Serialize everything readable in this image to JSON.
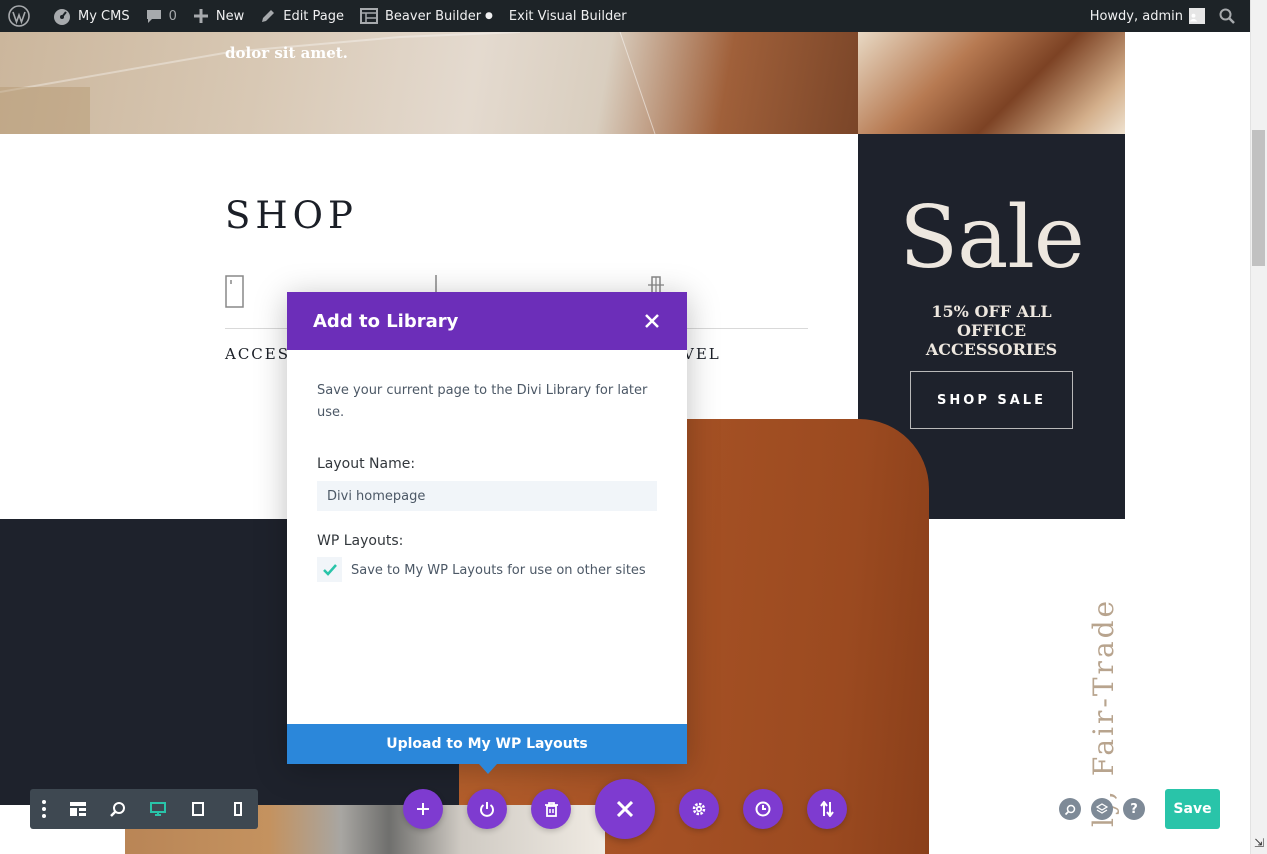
{
  "adminbar": {
    "site_name": "My CMS",
    "comments_count": "0",
    "new_label": "New",
    "edit_page_label": "Edit Page",
    "builder_label": "Beaver Builder",
    "exit_label": "Exit Visual Builder",
    "howdy_label": "Howdy, admin"
  },
  "page": {
    "hero_text": "dolor sit amet.",
    "shop_title": "SHOP",
    "shop_cat_left": "ACCES",
    "shop_cat_right": "VEL",
    "sale_title": "Sale",
    "sale_subtitle": "15% OFF ALL OFFICE ACCESSORIES",
    "shop_sale_button": "SHOP SALE",
    "vertical_text": "ly, Fair-Trade"
  },
  "modal": {
    "title": "Add to Library",
    "description": "Save your current page to the Divi Library for later use.",
    "layout_name_label": "Layout Name:",
    "layout_name_value": "Divi homepage",
    "wp_layouts_label": "WP Layouts:",
    "checkbox_label": "Save to My WP Layouts for use on other sites",
    "checkbox_checked": true,
    "upload_button": "Upload to My WP Layouts"
  },
  "builder": {
    "save_label": "Save"
  },
  "colors": {
    "adminbar_bg": "#1d2327",
    "modal_header": "#6c2eb9",
    "builder_purple": "#7e3bd0",
    "upload_blue": "#2b87da",
    "save_green": "#29c4a9",
    "dark_section": "#1e222c"
  }
}
